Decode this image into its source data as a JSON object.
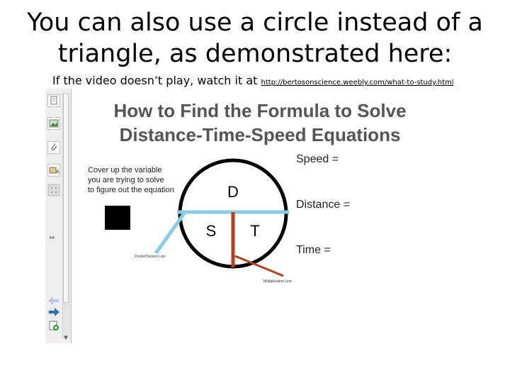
{
  "slide": {
    "title_line1": "You can also use a circle instead of a",
    "title_line2": "triangle, as demonstrated here:",
    "subtitle_prefix": "If the video doesn’t play, watch it at ",
    "subtitle_link": "http://bertosonscience.weebly.com/what-to-study.html"
  },
  "video": {
    "heading_line1": "How to Find the Formula to Solve",
    "heading_line2": "Distance-Time-Speed Equations",
    "instruction_line1": "Cover up the variable",
    "instruction_line2": "you are trying to solve",
    "instruction_line3": "to figure out the equation",
    "circle_top": "D",
    "circle_left": "S",
    "circle_right": "T",
    "divide_label": "Divide/Division Line",
    "multiply_label": "Multiplication Line",
    "speed_label": "Speed =",
    "distance_label": "Distance =",
    "time_label": "Time =",
    "colors": {
      "divide_line": "#87cde6",
      "multiply_line": "#b5421c",
      "circle": "#000000"
    }
  },
  "sidebar": {
    "tools": [
      "page-icon",
      "image-icon",
      "paperclip-icon",
      "gallery-icon",
      "dots-icon",
      "back-arrow-icon",
      "forward-arrow-icon",
      "add-page-icon"
    ],
    "side_arrow_glyph": "⇔",
    "scroll_down_glyph": "▼"
  }
}
